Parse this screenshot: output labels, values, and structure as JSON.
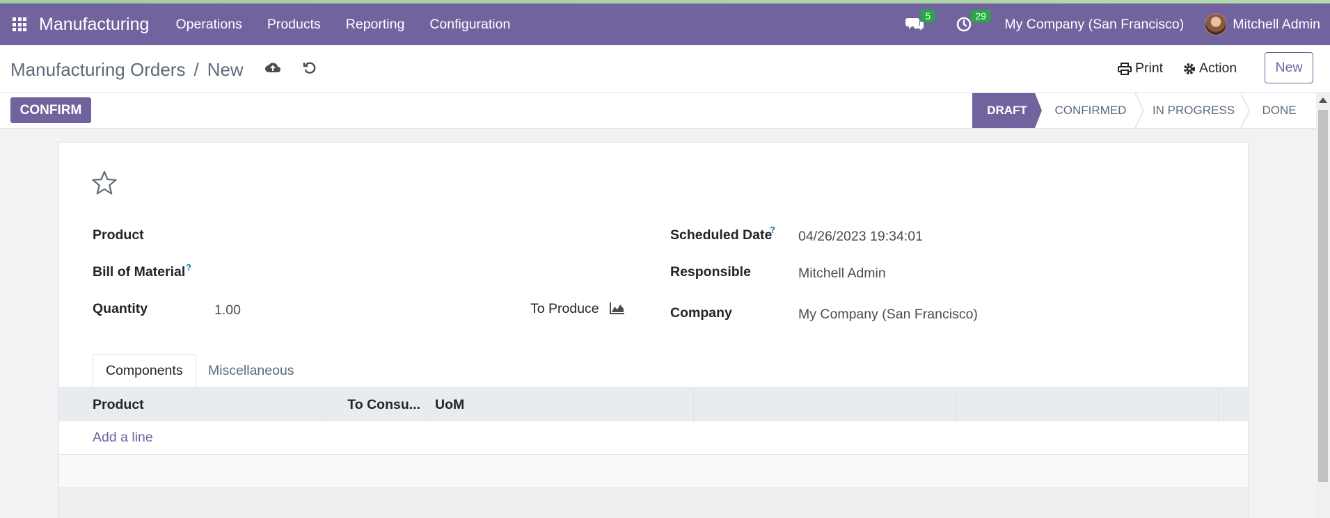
{
  "navbar": {
    "brand": "Manufacturing",
    "menu": [
      "Operations",
      "Products",
      "Reporting",
      "Configuration"
    ],
    "messages_count": "5",
    "activities_count": "29",
    "company": "My Company (San Francisco)",
    "user": "Mitchell Admin"
  },
  "control": {
    "breadcrumb_parent": "Manufacturing Orders",
    "breadcrumb_sep": "/",
    "breadcrumb_current": "New",
    "print_label": "Print",
    "action_label": "Action",
    "new_label": "New"
  },
  "status": {
    "confirm_label": "CONFIRM",
    "stages": [
      "DRAFT",
      "CONFIRMED",
      "IN PROGRESS",
      "DONE"
    ],
    "active_stage": "DRAFT"
  },
  "form": {
    "product_label": "Product",
    "bom_label": "Bill of Material",
    "help_mark": "?",
    "quantity_label": "Quantity",
    "quantity_value": "1.00",
    "to_produce_label": "To Produce",
    "scheduled_date_label": "Scheduled Date",
    "scheduled_date_value": "04/26/2023 19:34:01",
    "responsible_label": "Responsible",
    "responsible_value": "Mitchell Admin",
    "company_label": "Company",
    "company_value": "My Company (San Francisco)"
  },
  "tabs": {
    "components": "Components",
    "miscellaneous": "Miscellaneous"
  },
  "table": {
    "columns": [
      "Product",
      "To Consu...",
      "UoM"
    ],
    "add_line": "Add a line"
  },
  "colors": {
    "brand": "#71639e",
    "badge": "#28a745"
  }
}
